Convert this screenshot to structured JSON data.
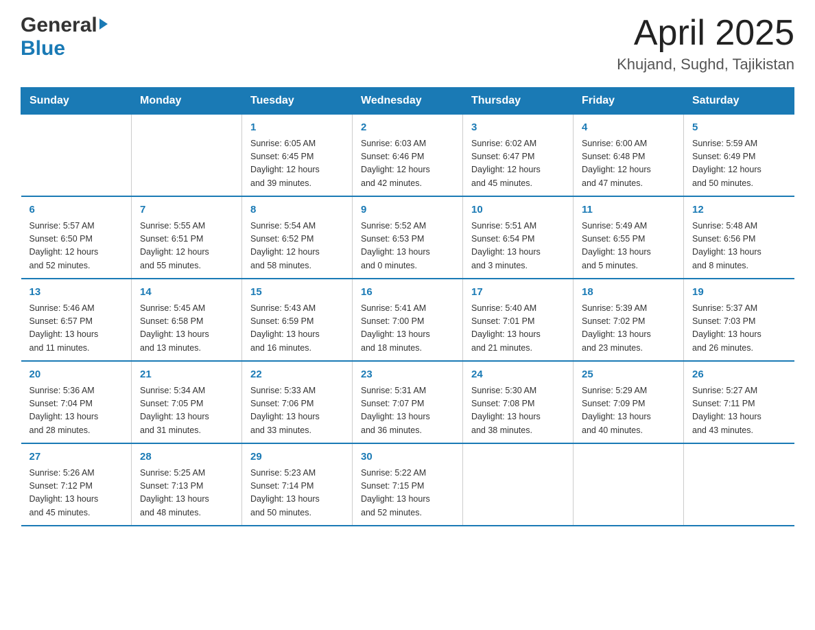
{
  "header": {
    "month_year": "April 2025",
    "location": "Khujand, Sughd, Tajikistan",
    "logo_general": "General",
    "logo_blue": "Blue"
  },
  "days_of_week": [
    "Sunday",
    "Monday",
    "Tuesday",
    "Wednesday",
    "Thursday",
    "Friday",
    "Saturday"
  ],
  "weeks": [
    [
      {
        "day": "",
        "info": ""
      },
      {
        "day": "",
        "info": ""
      },
      {
        "day": "1",
        "info": "Sunrise: 6:05 AM\nSunset: 6:45 PM\nDaylight: 12 hours\nand 39 minutes."
      },
      {
        "day": "2",
        "info": "Sunrise: 6:03 AM\nSunset: 6:46 PM\nDaylight: 12 hours\nand 42 minutes."
      },
      {
        "day": "3",
        "info": "Sunrise: 6:02 AM\nSunset: 6:47 PM\nDaylight: 12 hours\nand 45 minutes."
      },
      {
        "day": "4",
        "info": "Sunrise: 6:00 AM\nSunset: 6:48 PM\nDaylight: 12 hours\nand 47 minutes."
      },
      {
        "day": "5",
        "info": "Sunrise: 5:59 AM\nSunset: 6:49 PM\nDaylight: 12 hours\nand 50 minutes."
      }
    ],
    [
      {
        "day": "6",
        "info": "Sunrise: 5:57 AM\nSunset: 6:50 PM\nDaylight: 12 hours\nand 52 minutes."
      },
      {
        "day": "7",
        "info": "Sunrise: 5:55 AM\nSunset: 6:51 PM\nDaylight: 12 hours\nand 55 minutes."
      },
      {
        "day": "8",
        "info": "Sunrise: 5:54 AM\nSunset: 6:52 PM\nDaylight: 12 hours\nand 58 minutes."
      },
      {
        "day": "9",
        "info": "Sunrise: 5:52 AM\nSunset: 6:53 PM\nDaylight: 13 hours\nand 0 minutes."
      },
      {
        "day": "10",
        "info": "Sunrise: 5:51 AM\nSunset: 6:54 PM\nDaylight: 13 hours\nand 3 minutes."
      },
      {
        "day": "11",
        "info": "Sunrise: 5:49 AM\nSunset: 6:55 PM\nDaylight: 13 hours\nand 5 minutes."
      },
      {
        "day": "12",
        "info": "Sunrise: 5:48 AM\nSunset: 6:56 PM\nDaylight: 13 hours\nand 8 minutes."
      }
    ],
    [
      {
        "day": "13",
        "info": "Sunrise: 5:46 AM\nSunset: 6:57 PM\nDaylight: 13 hours\nand 11 minutes."
      },
      {
        "day": "14",
        "info": "Sunrise: 5:45 AM\nSunset: 6:58 PM\nDaylight: 13 hours\nand 13 minutes."
      },
      {
        "day": "15",
        "info": "Sunrise: 5:43 AM\nSunset: 6:59 PM\nDaylight: 13 hours\nand 16 minutes."
      },
      {
        "day": "16",
        "info": "Sunrise: 5:41 AM\nSunset: 7:00 PM\nDaylight: 13 hours\nand 18 minutes."
      },
      {
        "day": "17",
        "info": "Sunrise: 5:40 AM\nSunset: 7:01 PM\nDaylight: 13 hours\nand 21 minutes."
      },
      {
        "day": "18",
        "info": "Sunrise: 5:39 AM\nSunset: 7:02 PM\nDaylight: 13 hours\nand 23 minutes."
      },
      {
        "day": "19",
        "info": "Sunrise: 5:37 AM\nSunset: 7:03 PM\nDaylight: 13 hours\nand 26 minutes."
      }
    ],
    [
      {
        "day": "20",
        "info": "Sunrise: 5:36 AM\nSunset: 7:04 PM\nDaylight: 13 hours\nand 28 minutes."
      },
      {
        "day": "21",
        "info": "Sunrise: 5:34 AM\nSunset: 7:05 PM\nDaylight: 13 hours\nand 31 minutes."
      },
      {
        "day": "22",
        "info": "Sunrise: 5:33 AM\nSunset: 7:06 PM\nDaylight: 13 hours\nand 33 minutes."
      },
      {
        "day": "23",
        "info": "Sunrise: 5:31 AM\nSunset: 7:07 PM\nDaylight: 13 hours\nand 36 minutes."
      },
      {
        "day": "24",
        "info": "Sunrise: 5:30 AM\nSunset: 7:08 PM\nDaylight: 13 hours\nand 38 minutes."
      },
      {
        "day": "25",
        "info": "Sunrise: 5:29 AM\nSunset: 7:09 PM\nDaylight: 13 hours\nand 40 minutes."
      },
      {
        "day": "26",
        "info": "Sunrise: 5:27 AM\nSunset: 7:11 PM\nDaylight: 13 hours\nand 43 minutes."
      }
    ],
    [
      {
        "day": "27",
        "info": "Sunrise: 5:26 AM\nSunset: 7:12 PM\nDaylight: 13 hours\nand 45 minutes."
      },
      {
        "day": "28",
        "info": "Sunrise: 5:25 AM\nSunset: 7:13 PM\nDaylight: 13 hours\nand 48 minutes."
      },
      {
        "day": "29",
        "info": "Sunrise: 5:23 AM\nSunset: 7:14 PM\nDaylight: 13 hours\nand 50 minutes."
      },
      {
        "day": "30",
        "info": "Sunrise: 5:22 AM\nSunset: 7:15 PM\nDaylight: 13 hours\nand 52 minutes."
      },
      {
        "day": "",
        "info": ""
      },
      {
        "day": "",
        "info": ""
      },
      {
        "day": "",
        "info": ""
      }
    ]
  ]
}
